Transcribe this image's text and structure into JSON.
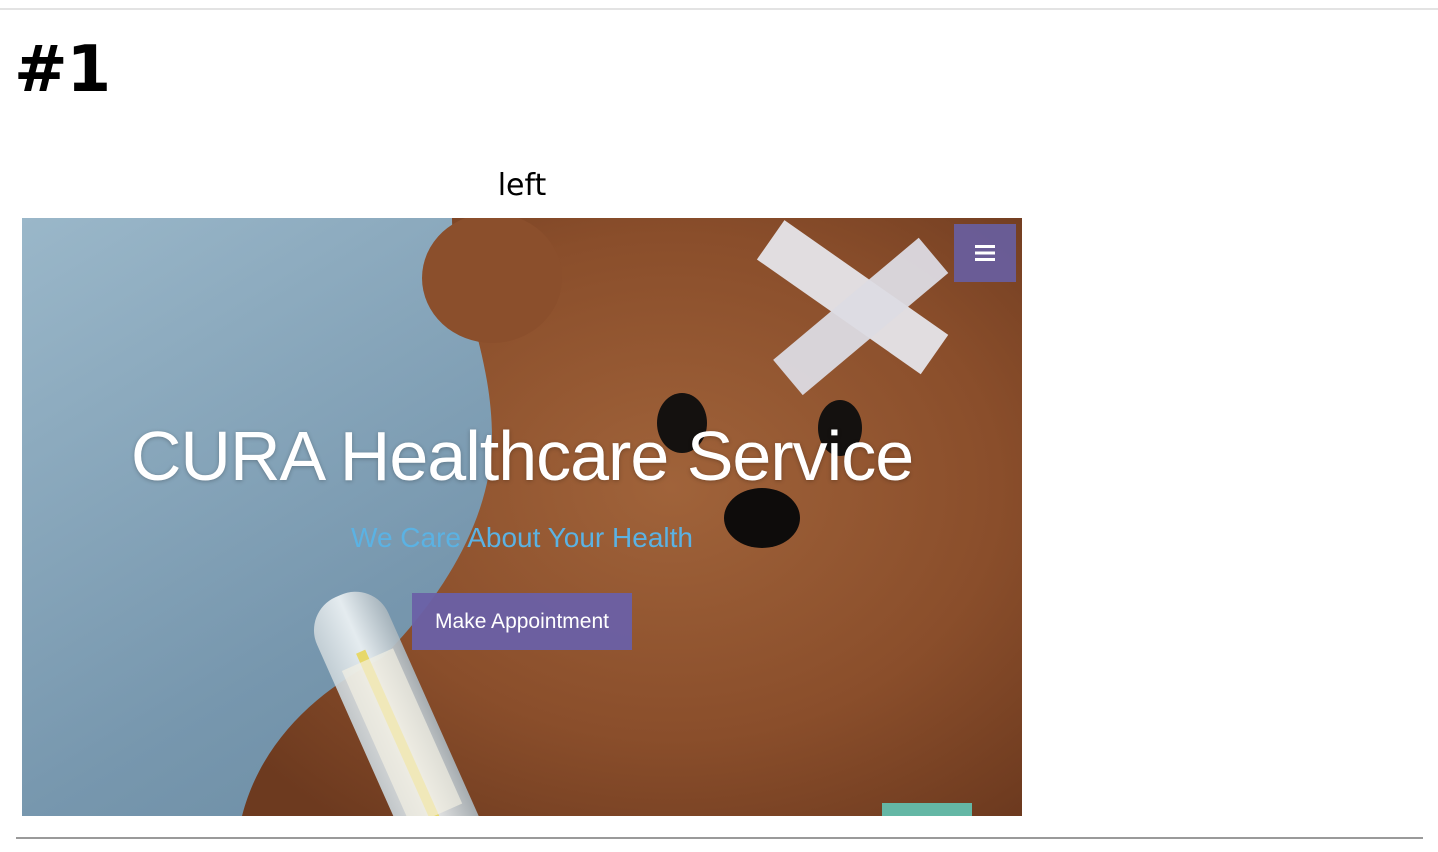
{
  "page": {
    "heading": "#1",
    "caption": "left"
  },
  "hero": {
    "title": "CURA Healthcare Service",
    "subtitle": "We Care About Your Health",
    "button_label": "Make Appointment",
    "menu_icon": "hamburger-menu-icon"
  },
  "colors": {
    "button_bg": "#6a60a6",
    "subtitle": "#5bb2e3",
    "title": "#ffffff"
  }
}
